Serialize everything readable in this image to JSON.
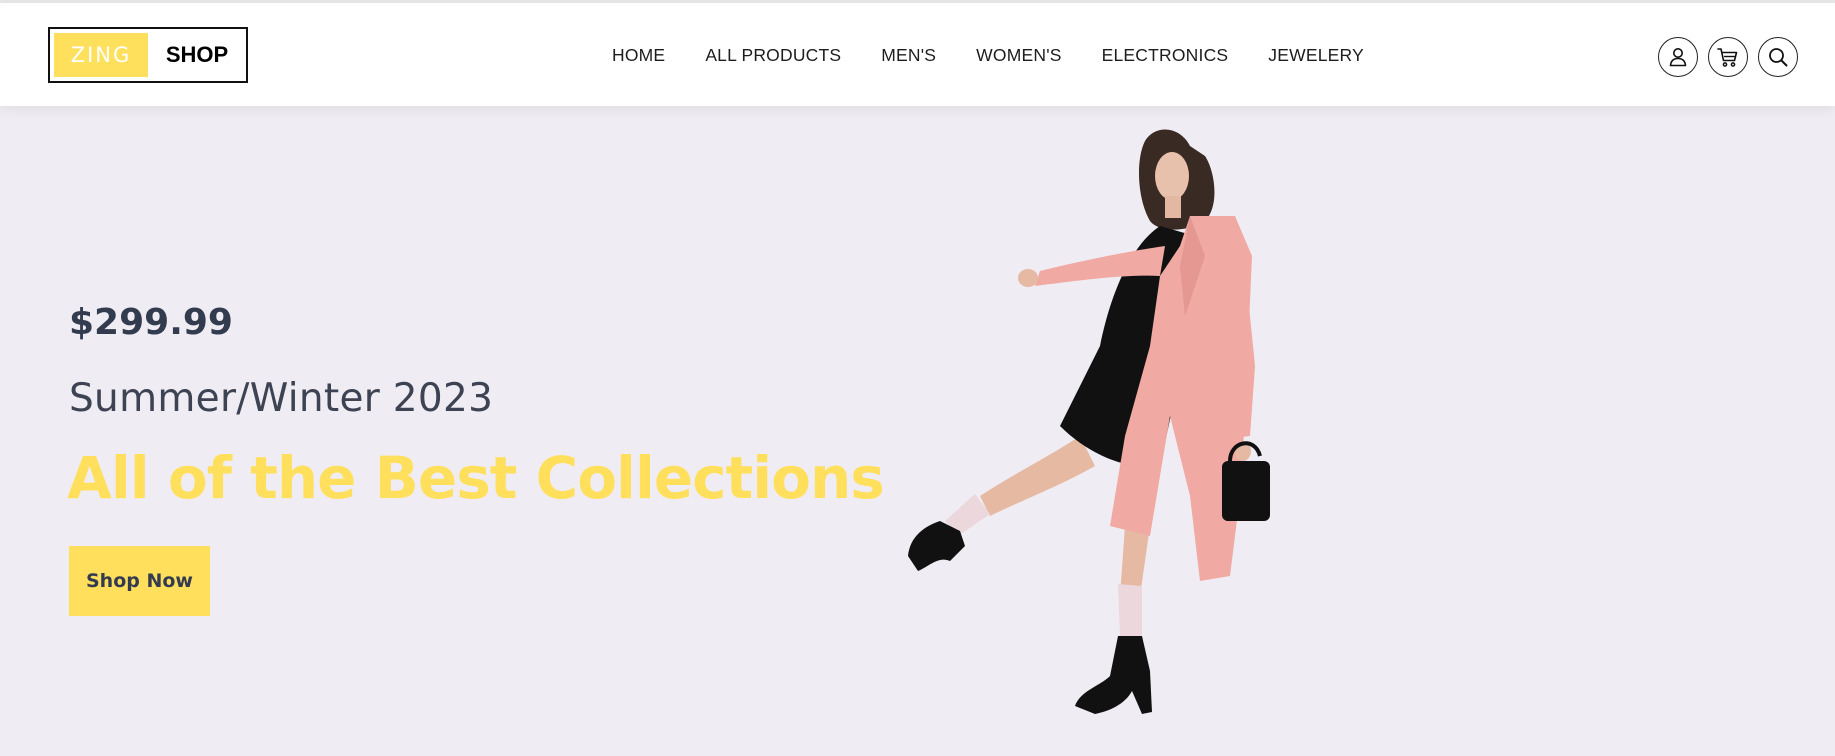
{
  "logo": {
    "part1": "ZING",
    "part2": "SHOP"
  },
  "nav": {
    "items": [
      "HOME",
      "ALL PRODUCTS",
      "MEN'S",
      "WOMEN'S",
      "ELECTRONICS",
      "JEWELERY"
    ]
  },
  "header_icons": [
    "user-icon",
    "cart-icon",
    "search-icon"
  ],
  "hero": {
    "price": "$299.99",
    "season": "Summer/Winter 2023",
    "headline": "All of the Best Collections",
    "cta_label": "Shop Now"
  },
  "colors": {
    "accent": "#ffdf5c",
    "hero_background": "#efedf3",
    "text_dark": "#333b4f"
  }
}
